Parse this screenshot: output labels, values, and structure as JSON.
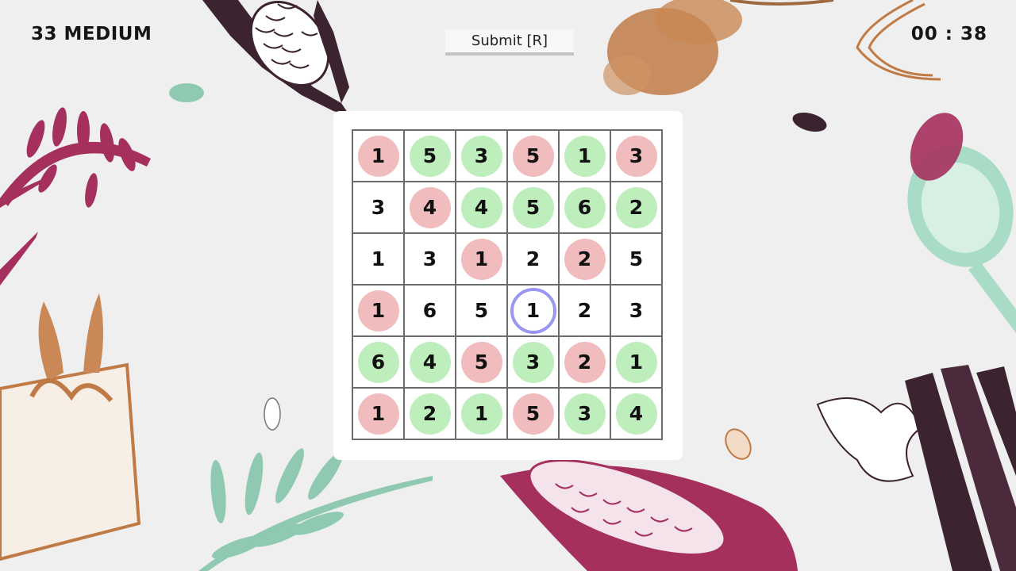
{
  "header": {
    "level": "33 MEDIUM",
    "submit_label": "Submit [R]",
    "timer": "00 : 38"
  },
  "colors": {
    "pink": "#f1bcbd",
    "green": "#bdeebb",
    "selected_ring": "#9b96f0",
    "grid_line": "#6b6b6b"
  },
  "grid": [
    [
      {
        "v": "1",
        "s": "pink"
      },
      {
        "v": "5",
        "s": "green"
      },
      {
        "v": "3",
        "s": "green"
      },
      {
        "v": "5",
        "s": "pink"
      },
      {
        "v": "1",
        "s": "green"
      },
      {
        "v": "3",
        "s": "pink"
      }
    ],
    [
      {
        "v": "3",
        "s": "none"
      },
      {
        "v": "4",
        "s": "pink"
      },
      {
        "v": "4",
        "s": "green"
      },
      {
        "v": "5",
        "s": "green"
      },
      {
        "v": "6",
        "s": "green"
      },
      {
        "v": "2",
        "s": "green"
      }
    ],
    [
      {
        "v": "1",
        "s": "none"
      },
      {
        "v": "3",
        "s": "none"
      },
      {
        "v": "1",
        "s": "pink"
      },
      {
        "v": "2",
        "s": "none"
      },
      {
        "v": "2",
        "s": "pink"
      },
      {
        "v": "5",
        "s": "none"
      }
    ],
    [
      {
        "v": "1",
        "s": "pink"
      },
      {
        "v": "6",
        "s": "none"
      },
      {
        "v": "5",
        "s": "none"
      },
      {
        "v": "1",
        "s": "selected"
      },
      {
        "v": "2",
        "s": "none"
      },
      {
        "v": "3",
        "s": "none"
      }
    ],
    [
      {
        "v": "6",
        "s": "green"
      },
      {
        "v": "4",
        "s": "green"
      },
      {
        "v": "5",
        "s": "pink"
      },
      {
        "v": "3",
        "s": "green"
      },
      {
        "v": "2",
        "s": "pink"
      },
      {
        "v": "1",
        "s": "green"
      }
    ],
    [
      {
        "v": "1",
        "s": "pink"
      },
      {
        "v": "2",
        "s": "green"
      },
      {
        "v": "1",
        "s": "green"
      },
      {
        "v": "5",
        "s": "pink"
      },
      {
        "v": "3",
        "s": "green"
      },
      {
        "v": "4",
        "s": "green"
      }
    ]
  ]
}
